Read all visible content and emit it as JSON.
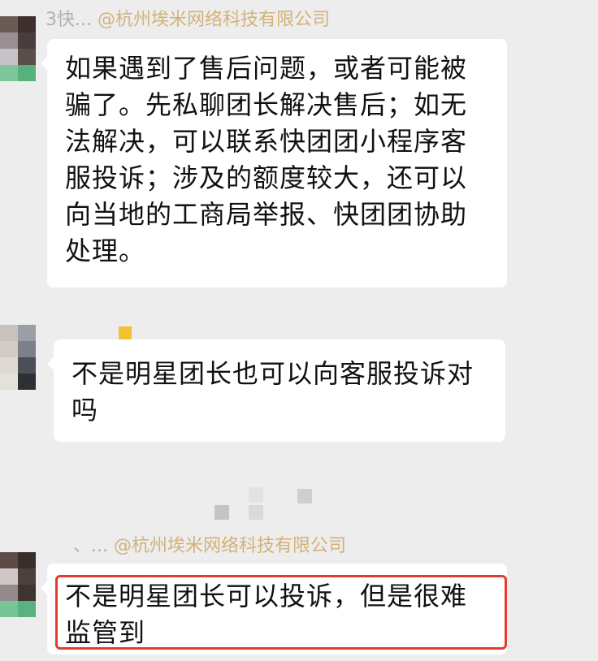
{
  "messages": [
    {
      "sender_prefix": "3快...",
      "mention": "@杭州埃米网络科技有限公司",
      "text": "如果遇到了售后问题，或者可能被骗了。先私聊团长解决售后；如无法解决，可以联系快团团小程序客服投诉；涉及的额度较大，还可以向当地的工商局举报、快团团协助处理。"
    },
    {
      "text": "不是明星团长也可以向客服投诉对吗"
    },
    {
      "sender_prefix": "、...",
      "mention": "@杭州埃米网络科技有限公司",
      "text": "不是明星团长可以投诉，但是很难监管到"
    }
  ],
  "colors": {
    "background": "#ededed",
    "bubble": "#ffffff",
    "mention": "#d2b27a",
    "highlight_border": "#e53b2e",
    "sender_gray": "#b0b0b0"
  }
}
